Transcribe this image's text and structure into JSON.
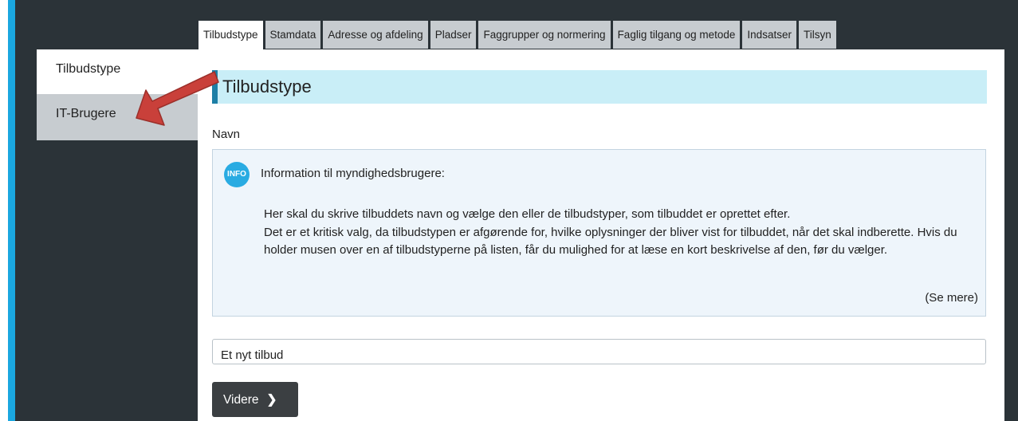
{
  "tabs": [
    {
      "label": "Tilbudstype",
      "active": true
    },
    {
      "label": "Stamdata",
      "active": false
    },
    {
      "label": "Adresse og afdeling",
      "active": false
    },
    {
      "label": "Pladser",
      "active": false
    },
    {
      "label": "Faggrupper og normering",
      "active": false
    },
    {
      "label": "Faglig tilgang og metode",
      "active": false
    },
    {
      "label": "Indsatser",
      "active": false
    },
    {
      "label": "Tilsyn",
      "active": false
    }
  ],
  "sidebar": {
    "items": [
      {
        "label": "Tilbudstype",
        "active": true
      },
      {
        "label": "IT-Brugere",
        "active": false
      }
    ]
  },
  "main": {
    "section_title": "Tilbudstype",
    "field_label": "Navn",
    "info": {
      "badge": "INFO",
      "heading": "Information til myndighedsbrugere:",
      "paragraph1": "Her skal du skrive tilbuddets navn og vælge den eller de tilbudstyper, som tilbuddet er oprettet efter.",
      "paragraph2": "Det er et kritisk valg, da tilbudstypen er afgørende for, hvilke oplysninger der bliver vist for tilbuddet, når det skal indberette. Hvis du holder musen over en af tilbudstyperne på listen, får du mulighed for at læse en kort beskrivelse af den, før du vælger.",
      "see_more": "(Se mere)"
    },
    "name_input_value": "Et nyt tilbud",
    "next_button_label": "Videre",
    "next_button_icon": "chevron-right-icon"
  },
  "colors": {
    "accent_bar": "#1aa7e0",
    "dark_background": "#2b3338",
    "title_band": "#c9eef7",
    "info_background": "#eef5fb",
    "annotation_arrow": "#c9403a"
  }
}
